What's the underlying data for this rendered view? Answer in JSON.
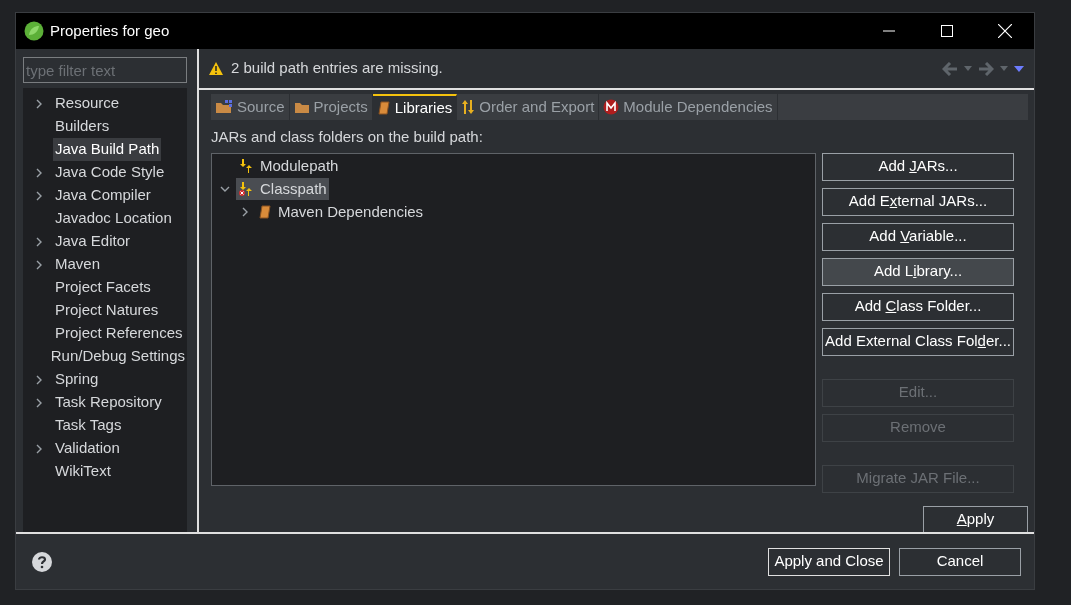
{
  "window": {
    "title": "Properties for geo"
  },
  "filter": {
    "placeholder": "type filter text"
  },
  "sidebar": {
    "items": [
      {
        "label": "Resource",
        "expandable": true,
        "selected": false
      },
      {
        "label": "Builders",
        "expandable": false,
        "selected": false
      },
      {
        "label": "Java Build Path",
        "expandable": false,
        "selected": true
      },
      {
        "label": "Java Code Style",
        "expandable": true,
        "selected": false
      },
      {
        "label": "Java Compiler",
        "expandable": true,
        "selected": false
      },
      {
        "label": "Javadoc Location",
        "expandable": false,
        "selected": false
      },
      {
        "label": "Java Editor",
        "expandable": true,
        "selected": false
      },
      {
        "label": "Maven",
        "expandable": true,
        "selected": false
      },
      {
        "label": "Project Facets",
        "expandable": false,
        "selected": false
      },
      {
        "label": "Project Natures",
        "expandable": false,
        "selected": false
      },
      {
        "label": "Project References",
        "expandable": false,
        "selected": false
      },
      {
        "label": "Run/Debug Settings",
        "expandable": false,
        "selected": false
      },
      {
        "label": "Spring",
        "expandable": true,
        "selected": false
      },
      {
        "label": "Task Repository",
        "expandable": true,
        "selected": false
      },
      {
        "label": "Task Tags",
        "expandable": false,
        "selected": false
      },
      {
        "label": "Validation",
        "expandable": true,
        "selected": false
      },
      {
        "label": "WikiText",
        "expandable": false,
        "selected": false
      }
    ]
  },
  "message": "2 build path entries are missing.",
  "tabs": [
    {
      "label": "Source",
      "kind": "source",
      "selected": false
    },
    {
      "label": "Projects",
      "kind": "folder",
      "selected": false
    },
    {
      "label": "Libraries",
      "kind": "book",
      "selected": true
    },
    {
      "label": "Order and Export",
      "kind": "order",
      "selected": false
    },
    {
      "label": "Module Dependencies",
      "kind": "module",
      "selected": false
    }
  ],
  "tree_label": "JARs and class folders on the build path:",
  "tree": [
    {
      "label": "Modulepath",
      "error": false,
      "selected": false,
      "kind": "path"
    },
    {
      "label": "Classpath",
      "error": true,
      "selected": true,
      "kind": "path",
      "expanded": true,
      "children": [
        {
          "label": "Maven Dependencies",
          "error": false,
          "selected": false,
          "kind": "library",
          "expanded": false
        }
      ]
    }
  ],
  "buttons": [
    {
      "before": "Add ",
      "mnemonic": "J",
      "after": "ARs...",
      "disabled": false,
      "hovered": false
    },
    {
      "before": "Add E",
      "mnemonic": "x",
      "after": "ternal JARs...",
      "disabled": false,
      "hovered": false
    },
    {
      "before": "Add ",
      "mnemonic": "V",
      "after": "ariable...",
      "disabled": false,
      "hovered": false
    },
    {
      "before": "Add L",
      "mnemonic": "i",
      "after": "brary...",
      "disabled": false,
      "hovered": true
    },
    {
      "before": "Add ",
      "mnemonic": "C",
      "after": "lass Folder...",
      "disabled": false,
      "hovered": false
    },
    {
      "before": "Add External Class Fol",
      "mnemonic": "d",
      "after": "er...",
      "disabled": false,
      "hovered": false
    },
    {
      "before": "Edit...",
      "disabled": true,
      "hovered": false
    },
    {
      "before": "Remove",
      "disabled": true,
      "hovered": false
    },
    {
      "before": "Migrate JAR File...",
      "disabled": true,
      "hovered": false
    }
  ],
  "apply": {
    "mnemonic": "A",
    "after": "pply"
  },
  "footer_buttons": [
    {
      "label": "Apply and Close"
    },
    {
      "label": "Cancel"
    }
  ]
}
